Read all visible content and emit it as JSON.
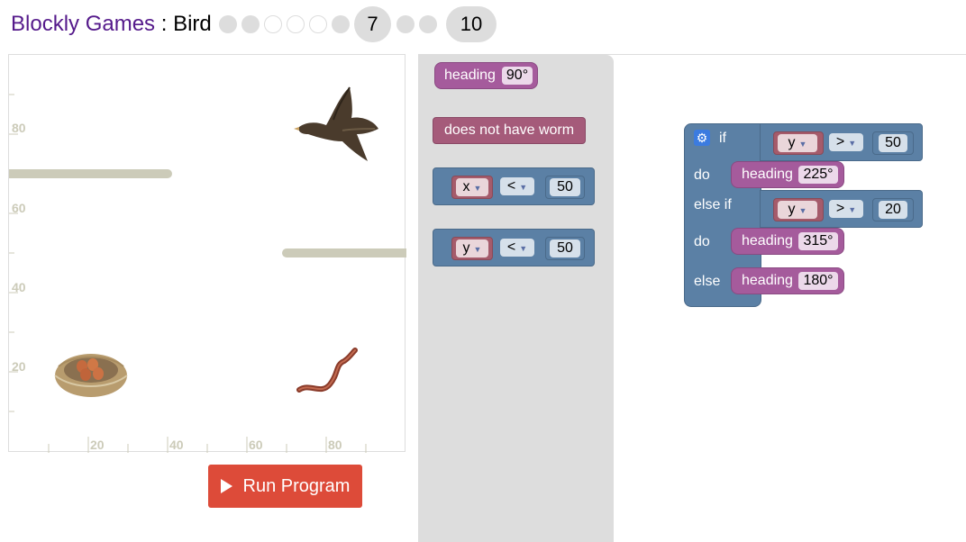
{
  "header": {
    "app_name": "Blockly Games",
    "separator": " : ",
    "game_name": "Bird",
    "current_level": "7",
    "max_level": "10"
  },
  "viz": {
    "y_ticks": [
      "80",
      "60",
      "40",
      "20"
    ],
    "x_ticks": [
      "20",
      "40",
      "60",
      "80"
    ]
  },
  "run_button": {
    "label": "Run Program"
  },
  "flyout": {
    "heading_block": {
      "label": "heading",
      "value": "90°"
    },
    "no_worm_block": {
      "label": "does not have worm"
    },
    "x_compare": {
      "var": "x",
      "op": "<",
      "value": "50"
    },
    "y_compare": {
      "var": "y",
      "op": "<",
      "value": "50"
    }
  },
  "workspace": {
    "if_label": "if",
    "do_label": "do",
    "else_if_label": "else if",
    "else_label": "else",
    "cond1": {
      "var": "y",
      "op": ">",
      "value": "50"
    },
    "head1": {
      "label": "heading",
      "value": "225°"
    },
    "cond2": {
      "var": "y",
      "op": ">",
      "value": "20"
    },
    "head2": {
      "label": "heading",
      "value": "315°"
    },
    "head3": {
      "label": "heading",
      "value": "180°"
    }
  },
  "colors": {
    "logic_block": "#5b80a5",
    "heading_block": "#a55b9c",
    "variable_block": "#a55b6b",
    "run_button": "#dd4b39",
    "wall": "#cccbb9"
  }
}
